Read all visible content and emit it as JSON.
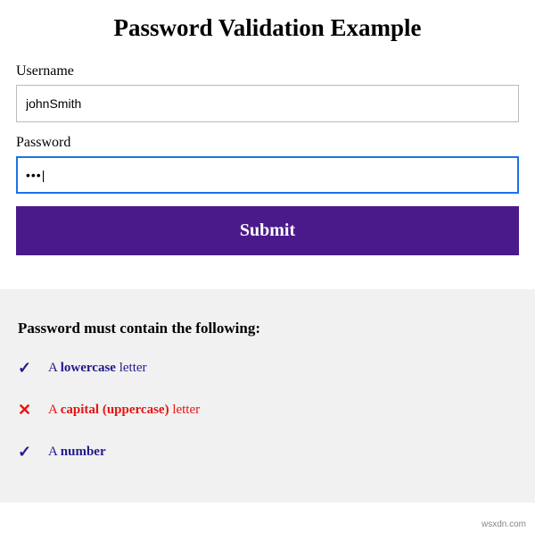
{
  "page": {
    "title": "Password Validation Example"
  },
  "form": {
    "username": {
      "label": "Username",
      "value": "johnSmith"
    },
    "password": {
      "label": "Password",
      "value": "•••"
    },
    "submit_label": "Submit"
  },
  "rules": {
    "heading": "Password must contain the following:",
    "items": [
      {
        "status": "valid",
        "icon": "✓",
        "prefix": "A ",
        "emphasis": "lowercase",
        "suffix": " letter"
      },
      {
        "status": "invalid",
        "icon": "✕",
        "prefix": "A ",
        "emphasis": "capital (uppercase)",
        "suffix": " letter"
      },
      {
        "status": "valid",
        "icon": "✓",
        "prefix": "A ",
        "emphasis": "number",
        "suffix": ""
      }
    ]
  },
  "watermark": "wsxdn.com"
}
